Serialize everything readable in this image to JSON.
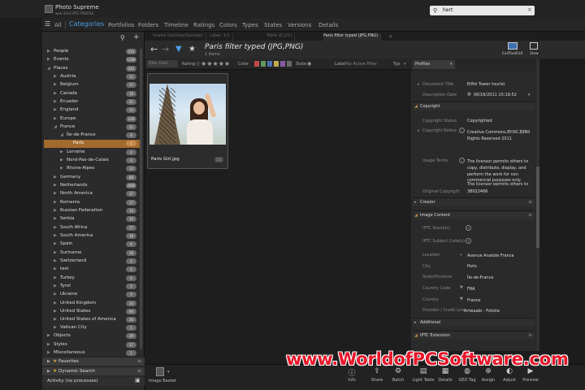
{
  "app": {
    "title": "Photo Supreme",
    "subtitle": "web-2024 IPTC PROFILE"
  },
  "search": {
    "value": "hert"
  },
  "nav": {
    "all": "All",
    "tabs": [
      "Categories",
      "Portfolios",
      "Folders",
      "Timeline",
      "Ratings",
      "Colors",
      "Types",
      "States",
      "Versions",
      "Details"
    ]
  },
  "sidebar": {
    "items": [
      {
        "label": "People",
        "count": "453"
      },
      {
        "label": "Events",
        "count": "1260"
      },
      {
        "label": "Places",
        "count": "241"
      },
      {
        "label": "Austria",
        "count": "12"
      },
      {
        "label": "Belgium",
        "count": "37"
      },
      {
        "label": "Canada",
        "count": "18"
      },
      {
        "label": "Ecuador",
        "count": "21"
      },
      {
        "label": "England",
        "count": "12"
      },
      {
        "label": "Europe",
        "count": "106"
      },
      {
        "label": "France",
        "count": "51"
      },
      {
        "label": "Île-de-France",
        "count": "8"
      },
      {
        "label": "Paris",
        "count": "1"
      },
      {
        "label": "Lorraine",
        "count": "4"
      },
      {
        "label": "Nord-Pas-de-Calais",
        "count": "9"
      },
      {
        "label": "Rhone-Alpes",
        "count": "14"
      },
      {
        "label": "Germany",
        "count": "88"
      },
      {
        "label": "Netherlands",
        "count": "2885"
      },
      {
        "label": "North America",
        "count": "37"
      },
      {
        "label": "Romania",
        "count": "17"
      },
      {
        "label": "Russian Federation",
        "count": "14"
      },
      {
        "label": "Serbia",
        "count": "14"
      },
      {
        "label": "South Africa",
        "count": "77"
      },
      {
        "label": "South America",
        "count": "18"
      },
      {
        "label": "Spain",
        "count": "8"
      },
      {
        "label": "Suriname",
        "count": "28"
      },
      {
        "label": "Switzerland",
        "count": "4"
      },
      {
        "label": "test",
        "count": "4"
      },
      {
        "label": "Turkey",
        "count": "8"
      },
      {
        "label": "Tyrol",
        "count": "5"
      },
      {
        "label": "Ukraine",
        "count": "9"
      },
      {
        "label": "United Kingdom",
        "count": "14"
      },
      {
        "label": "United States",
        "count": "94"
      },
      {
        "label": "United States of America",
        "count": "20"
      },
      {
        "label": "Vatican City",
        "count": "5"
      },
      {
        "label": "Objects",
        "count": "29"
      },
      {
        "label": "Styles",
        "count": "17"
      },
      {
        "label": "Miscellaneous",
        "count": "1"
      }
    ],
    "panels": {
      "favorites": "Favorites",
      "dynamic_search": "Dynamic Search"
    },
    "activity": "Activity (no processes)"
  },
  "doc_tabs": [
    "Imatra Desktop/Samples",
    "Label: 1/1",
    "Table (0,1/1)",
    "Paris filter typed (JPG,PNG)"
  ],
  "content": {
    "title": "Paris filter typed (JPG,PNG)",
    "count": "1 Items"
  },
  "filterbar": {
    "select": "Filter Field",
    "rating_label": "Rating",
    "stars": "☆★★★★★",
    "color_label": "Color",
    "swatch_colors": [
      "#c04a4a",
      "#5e9a5e",
      "#4a6fb0",
      "#c2a94a",
      "#8a5aa8",
      "#6a6a6a"
    ],
    "state_label": "State",
    "label_label": "Label",
    "label_value": "No Active Filter",
    "type_label": "Typ"
  },
  "thumb": {
    "filename": "Paris Girl.jpg",
    "badge": "1/1"
  },
  "right_toolbar": {
    "exif": "ExifToolGUI",
    "view": "View"
  },
  "right_panel": {
    "profile": "Profiles",
    "document_title": {
      "key": "Document Title",
      "value": "Eiffel Tower tourist"
    },
    "description_date": {
      "key": "Description Date",
      "value": "06/16/2011  15:19:52"
    },
    "sections": {
      "copyright": "Copyright",
      "creator": "Creator",
      "image_content": "Image Content",
      "additional": "Additional",
      "iptc_extension": "IPTC Extension"
    },
    "copyright_status": {
      "key": "Copyright Status",
      "value": "Copyrighted"
    },
    "copyright_notice": {
      "key": "Copyright Notice",
      "value1": "Creative Commons.BY.NC.ND",
      "value2": "Rights Reserved 2011",
      "suffix": "All"
    },
    "usage_terms": {
      "key": "Usage Terms",
      "value1": "The licensor permits others to",
      "value2": "copy, distribute, display, and",
      "value3": "perform the work for non",
      "value4": "commercial purposes only.",
      "value5": "The licensor permits others to"
    },
    "original_copyright": {
      "key": "Original Copyright",
      "value": "38022466"
    },
    "iptc_scene": {
      "key": "IPTC Scene(s)"
    },
    "iptc_subject": {
      "key": "IPTC Subject Code(s)"
    },
    "location": {
      "key": "Location",
      "value": "Avenue Anatole France"
    },
    "city": {
      "key": "City",
      "value": "Paris"
    },
    "state": {
      "key": "State/Province",
      "value": "Île-de-France"
    },
    "country_code": {
      "key": "Country Code",
      "value": "FRA"
    },
    "country": {
      "key": "Country",
      "value": "France"
    },
    "provider": {
      "key": "Provider / Credit Line",
      "value": "Artwaabi - Fotolia"
    }
  },
  "bottombar": {
    "basket": "Image Basket",
    "items": [
      "Info",
      "Share",
      "Batch",
      "Light Table",
      "Details",
      "GEO Tag",
      "Assign",
      "Adjust",
      "Preview"
    ]
  },
  "watermark": "www.WorldofPCSoftware.com"
}
